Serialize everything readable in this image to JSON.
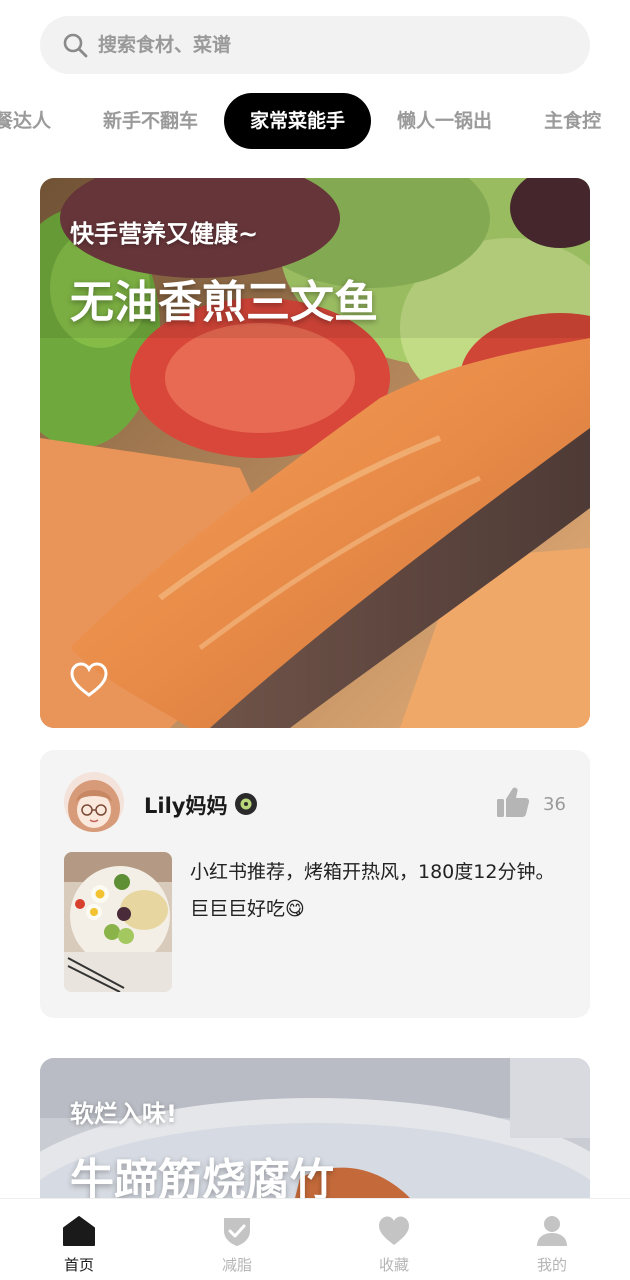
{
  "search": {
    "placeholder": "搜索食材、菜谱",
    "icon": "search-icon"
  },
  "tabs": [
    {
      "label": "餐达人",
      "active": false
    },
    {
      "label": "新手不翻车",
      "active": false
    },
    {
      "label": "家常菜能手",
      "active": true
    },
    {
      "label": "懒人一锅出",
      "active": false
    },
    {
      "label": "主食控",
      "active": false
    }
  ],
  "featured": {
    "subtitle": "快手营养又健康~",
    "title": "无油香煎三文鱼",
    "favorite_icon": "heart-outline-icon"
  },
  "comment": {
    "username": "Lily妈妈",
    "verified_icon": "verified-badge-icon",
    "like_count": "36",
    "like_icon": "thumbs-up-icon",
    "text": "小红书推荐，烤箱开热风，180度12分钟。巨巨巨好吃😋"
  },
  "second_card": {
    "subtitle": "软烂入味!",
    "title": "牛蹄筋烧腐竹"
  },
  "nav": [
    {
      "label": "首页",
      "icon": "home-icon",
      "active": true
    },
    {
      "label": "减脂",
      "icon": "shield-check-icon",
      "active": false
    },
    {
      "label": "收藏",
      "icon": "heart-icon",
      "active": false
    },
    {
      "label": "我的",
      "icon": "user-icon",
      "active": false
    }
  ],
  "colors": {
    "active_tab_bg": "#000000",
    "active_tab_text": "#ffffff",
    "inactive_text": "#9a9a9a",
    "card_bg": "#f4f4f4",
    "nav_inactive": "#b5b5b5"
  }
}
